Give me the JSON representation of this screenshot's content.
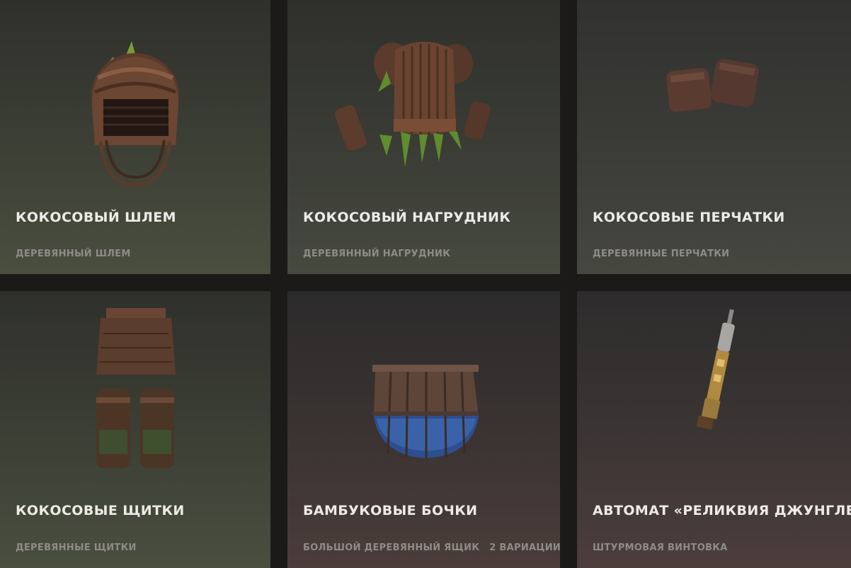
{
  "items": [
    {
      "title": "КОКОСОВЫЙ ШЛЕМ",
      "subtitle": "ДЕРЕВЯННЫЙ ШЛЕМ",
      "image": "coconut-helmet-image"
    },
    {
      "title": "КОКОСОВЫЙ НАГРУДНИК",
      "subtitle": "ДЕРЕВЯННЫЙ НАГРУДНИК",
      "image": "coconut-chestplate-image"
    },
    {
      "title": "КОКОСОВЫЕ ПЕРЧАТКИ",
      "subtitle": "ДЕРЕВЯННЫЕ ПЕРЧАТКИ",
      "image": "coconut-gloves-image"
    },
    {
      "title": "КОКОСОВЫЕ ЩИТКИ",
      "subtitle": "ДЕРЕВЯННЫЕ ЩИТКИ",
      "image": "coconut-shinguards-image"
    },
    {
      "title": "БАМБУКОВЫЕ БОЧКИ",
      "subtitle": "БОЛЬШОЙ ДЕРЕВЯННЫЙ ЯЩИК",
      "variations": "2 ВАРИАЦИИ",
      "image": "bamboo-barrels-image"
    },
    {
      "title": "АВТОМАТ «РЕЛИКВИЯ ДЖУНГЛЕЙ»",
      "subtitle": "ШТУРМОВАЯ ВИНТОВКА",
      "image": "jungle-relic-rifle-image"
    }
  ],
  "colors": {
    "title": "#ecebe6",
    "subtitle": "#8e8c86",
    "background": "#1b1a19"
  }
}
